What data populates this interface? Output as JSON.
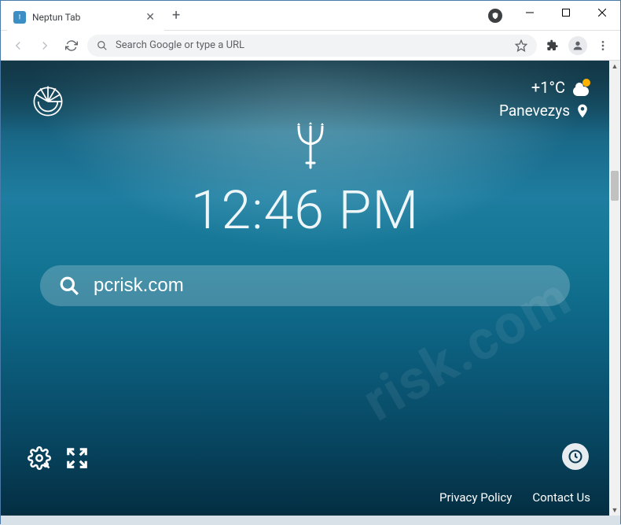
{
  "window": {
    "tab_title": "Neptun Tab"
  },
  "toolbar": {
    "omnibox_placeholder": "Search Google or type a URL"
  },
  "page": {
    "weather": {
      "temp": "+1°C",
      "location": "Panevezys"
    },
    "clock": "12:46 PM",
    "search_value": "pcrisk.com",
    "footer": {
      "privacy": "Privacy Policy",
      "contact": "Contact Us"
    }
  }
}
